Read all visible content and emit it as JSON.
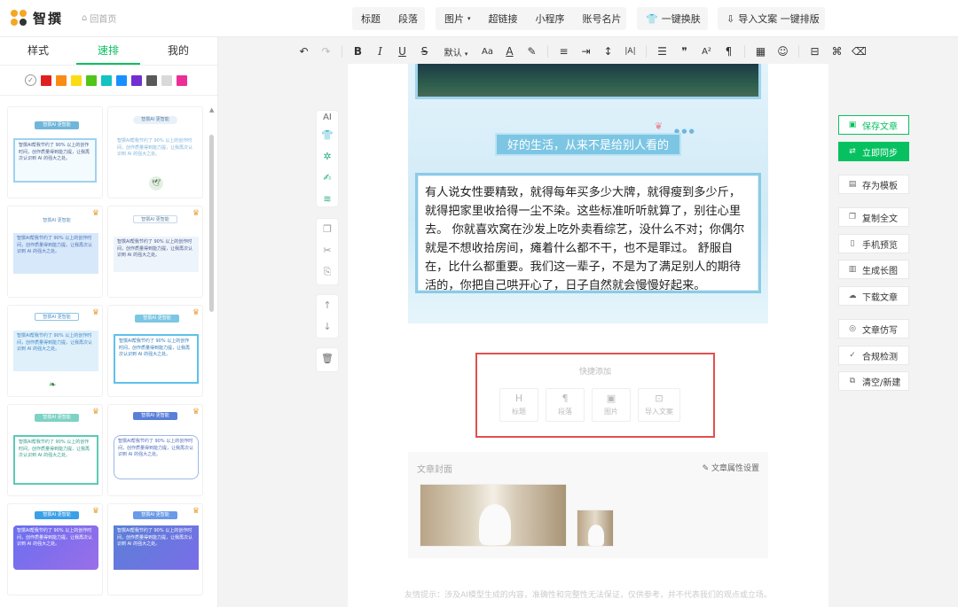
{
  "app": {
    "name": "智撰",
    "home": "回首页"
  },
  "toolbar_groups": [
    [
      "标题",
      "段落"
    ],
    [
      "图片",
      "超链接",
      "小程序",
      "账号名片"
    ],
    [
      "一键换肤"
    ],
    [
      "导入文案 一键排版"
    ]
  ],
  "left_tabs": [
    "样式",
    "速排",
    "我的"
  ],
  "swatches": [
    "#e02020",
    "#fa8c16",
    "#fadb14",
    "#52c41a",
    "#13c2c2",
    "#1890ff",
    "#722ed1",
    "#595959",
    "#d9d9d9",
    "#eb2f96"
  ],
  "cards": {
    "title": "智撰AI 更智能",
    "body": "智撰AI帮我节约了 90% 以上的创作时间，创作质量得到能力提，让我再次认识到 AI 的强大之处。"
  },
  "format": {
    "font": "默认"
  },
  "ai_label": "AI",
  "article": {
    "heading": "好的生活，从来不是给别人看的",
    "paragraph": "有人说女性要精致，就得每年买多少大牌，就得瘦到多少斤，就得把家里收拾得一尘不染。这些标准听听就算了，别往心里去。 你就喜欢窝在沙发上吃外卖看综艺，没什么不对；你偶尔就是不想收拾房间，瘫着什么都不干，也不是罪过。 舒服自在，比什么都重要。我们这一辈子，不是为了满足别人的期待活的，你把自己哄开心了，日子自然就会慢慢好起来。"
  },
  "quick_add": {
    "title": "快捷添加",
    "items": [
      "标题",
      "段落",
      "图片",
      "导入文案"
    ]
  },
  "cover": {
    "title": "文章封面",
    "settings": "文章属性设置"
  },
  "footer_note": "友情提示：涉及AI模型生成的内容，准确性和完整性无法保证，仅供参考，并不代表我们的观点或立场。",
  "right_actions": [
    "保存文章",
    "立即同步",
    "存为模板",
    "复制全文",
    "手机预览",
    "生成长图",
    "下载文章",
    "文章仿写",
    "合规检测",
    "清空/新建"
  ]
}
